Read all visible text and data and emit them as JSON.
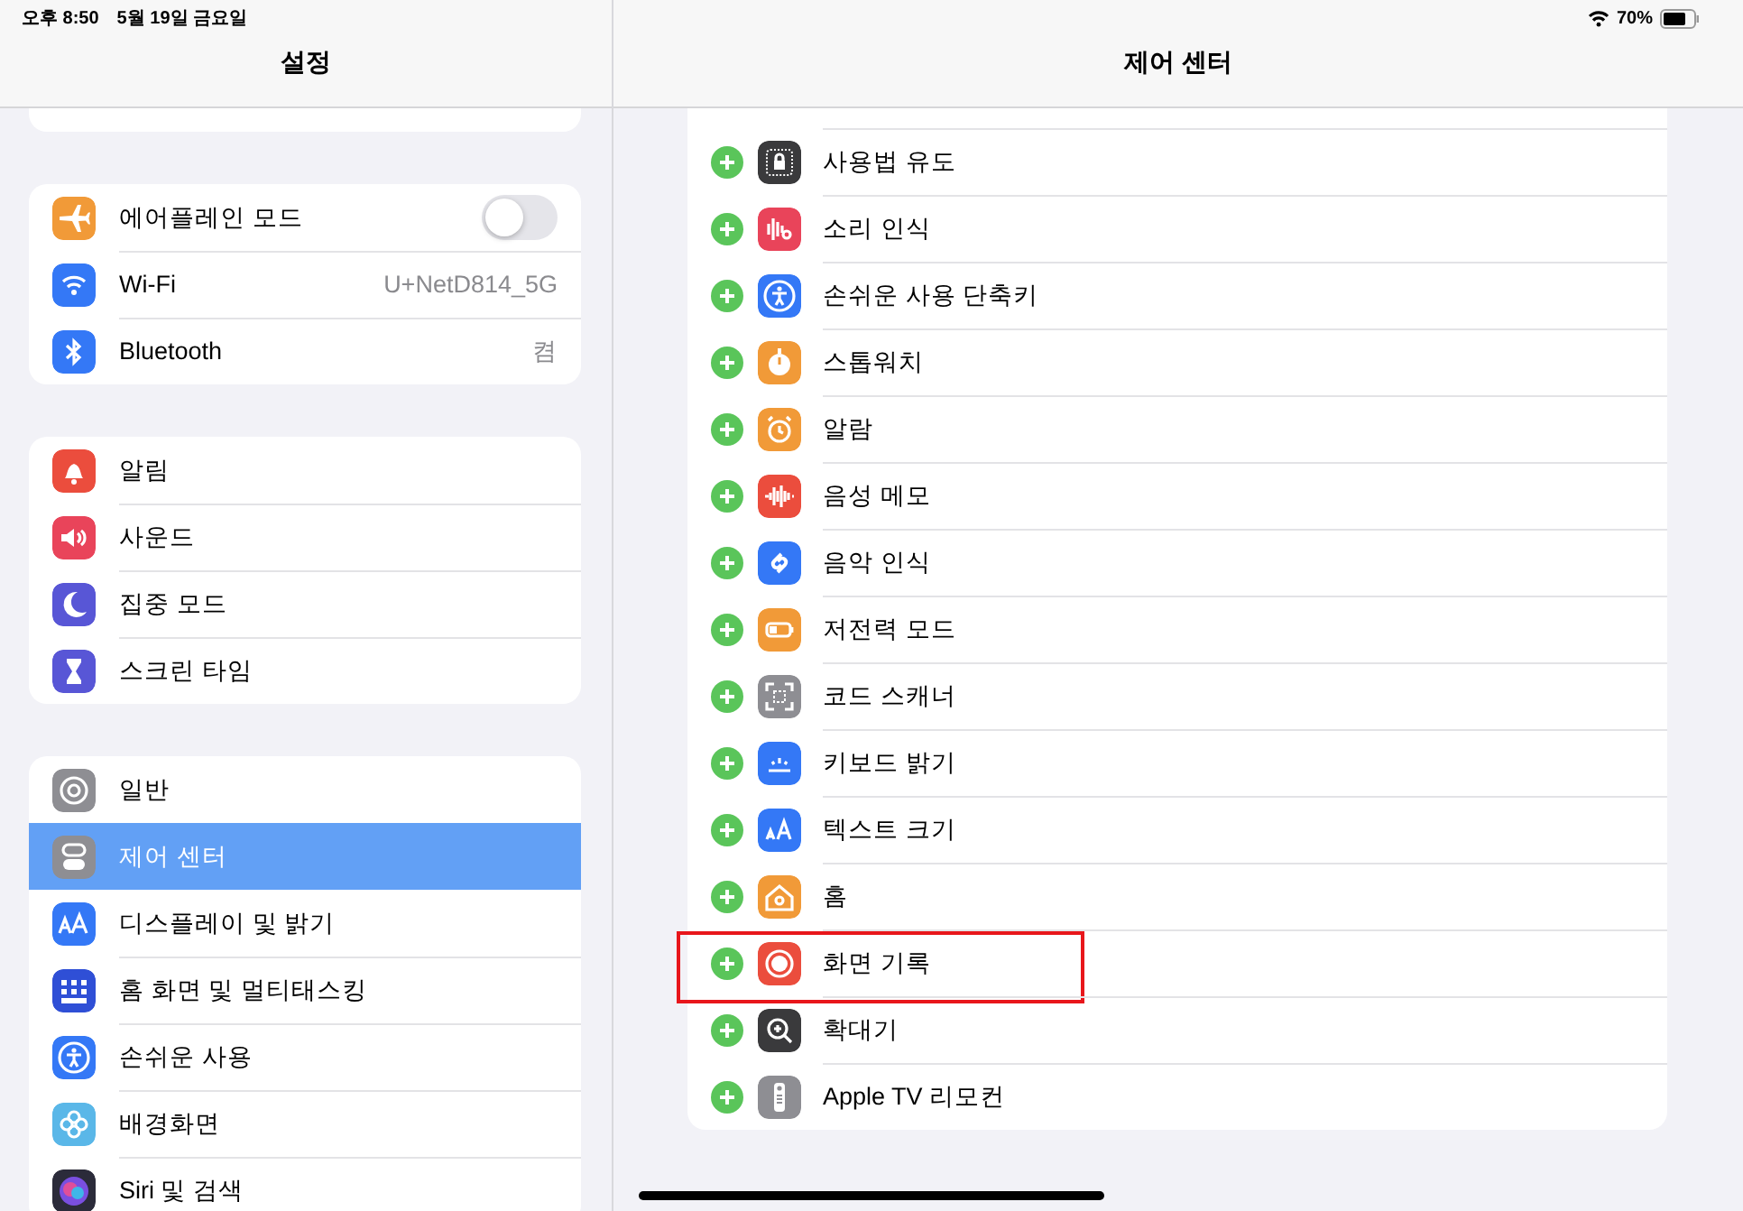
{
  "status_bar": {
    "time": "오후 8:50",
    "date": "5월 19일 금요일",
    "battery": "70%"
  },
  "sidebar": {
    "title": "설정",
    "groups": [
      [
        {
          "kind": "toggle",
          "label": "에어플레인 모드",
          "on": false,
          "selected": false,
          "color": "#f19a38"
        },
        {
          "kind": "value",
          "label": "Wi-Fi",
          "value": "U+NetD814_5G",
          "selected": false,
          "color": "#3478f6"
        },
        {
          "kind": "value",
          "label": "Bluetooth",
          "value": "켬",
          "selected": false,
          "color": "#3478f6"
        }
      ],
      [
        {
          "kind": "link",
          "label": "알림",
          "selected": false,
          "color": "#eb4d3d"
        },
        {
          "kind": "link",
          "label": "사운드",
          "selected": false,
          "color": "#e9445a"
        },
        {
          "kind": "link",
          "label": "집중 모드",
          "selected": false,
          "color": "#5856d6"
        },
        {
          "kind": "link",
          "label": "스크린 타임",
          "selected": false,
          "color": "#5856d6"
        }
      ],
      [
        {
          "kind": "link",
          "label": "일반",
          "selected": false,
          "color": "#8e8e93"
        },
        {
          "kind": "link",
          "label": "제어 센터",
          "selected": true,
          "color": "#8e8e93"
        },
        {
          "kind": "link",
          "label": "디스플레이 및 밝기",
          "selected": false,
          "color": "#3478f6"
        },
        {
          "kind": "link",
          "label": "홈 화면 및 멀티태스킹",
          "selected": false,
          "color": "#2f4fd6"
        },
        {
          "kind": "link",
          "label": "손쉬운 사용",
          "selected": false,
          "color": "#3478f6"
        },
        {
          "kind": "link",
          "label": "배경화면",
          "selected": false,
          "color": "#5ab7e8"
        },
        {
          "kind": "link",
          "label": "Siri 및 검색",
          "selected": false,
          "color": "#2b2b3a"
        }
      ]
    ]
  },
  "detail": {
    "title": "제어 센터",
    "controls": [
      {
        "label": "사용법 유도",
        "color": "#3a3a3c",
        "highlighted": false
      },
      {
        "label": "소리 인식",
        "color": "#e9445a",
        "highlighted": false
      },
      {
        "label": "손쉬운 사용 단축키",
        "color": "#3478f6",
        "highlighted": false
      },
      {
        "label": "스톱워치",
        "color": "#f19a38",
        "highlighted": false
      },
      {
        "label": "알람",
        "color": "#f19a38",
        "highlighted": false
      },
      {
        "label": "음성 메모",
        "color": "#eb4d3d",
        "highlighted": false
      },
      {
        "label": "음악 인식",
        "color": "#3478f6",
        "highlighted": false
      },
      {
        "label": "저전력 모드",
        "color": "#f19a38",
        "highlighted": false
      },
      {
        "label": "코드 스캐너",
        "color": "#8e8e93",
        "highlighted": false
      },
      {
        "label": "키보드 밝기",
        "color": "#3478f6",
        "highlighted": false
      },
      {
        "label": "텍스트 크기",
        "color": "#3478f6",
        "highlighted": false
      },
      {
        "label": "홈",
        "color": "#f19a38",
        "highlighted": false
      },
      {
        "label": "화면 기록",
        "color": "#eb4d3d",
        "highlighted": true
      },
      {
        "label": "확대기",
        "color": "#3a3a3c",
        "highlighted": false
      },
      {
        "label": "Apple TV 리모컨",
        "color": "#8e8e93",
        "highlighted": false
      }
    ]
  }
}
